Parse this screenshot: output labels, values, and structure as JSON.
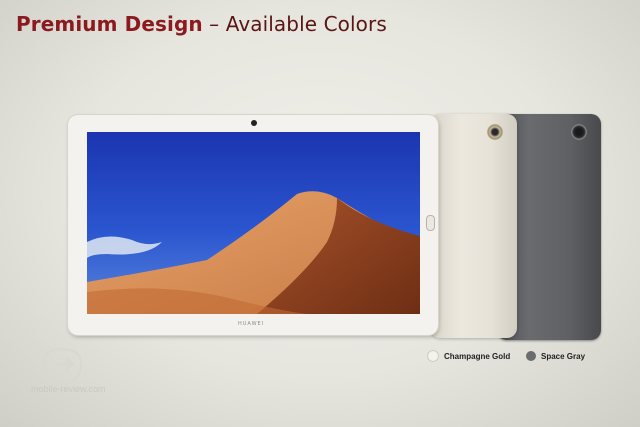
{
  "title": {
    "bold": "Premium Design",
    "rest": " – Available Colors",
    "bold_color": "#8b1a1e",
    "rest_color": "#5a1516"
  },
  "front_tablet": {
    "logo_text": "HUAWEI"
  },
  "colors": [
    {
      "label": "Champagne Gold",
      "swatch": "#f4f2ec"
    },
    {
      "label": "Space Gray",
      "swatch": "#6b6c70"
    }
  ],
  "watermark": {
    "text": "mobile-review.com"
  }
}
